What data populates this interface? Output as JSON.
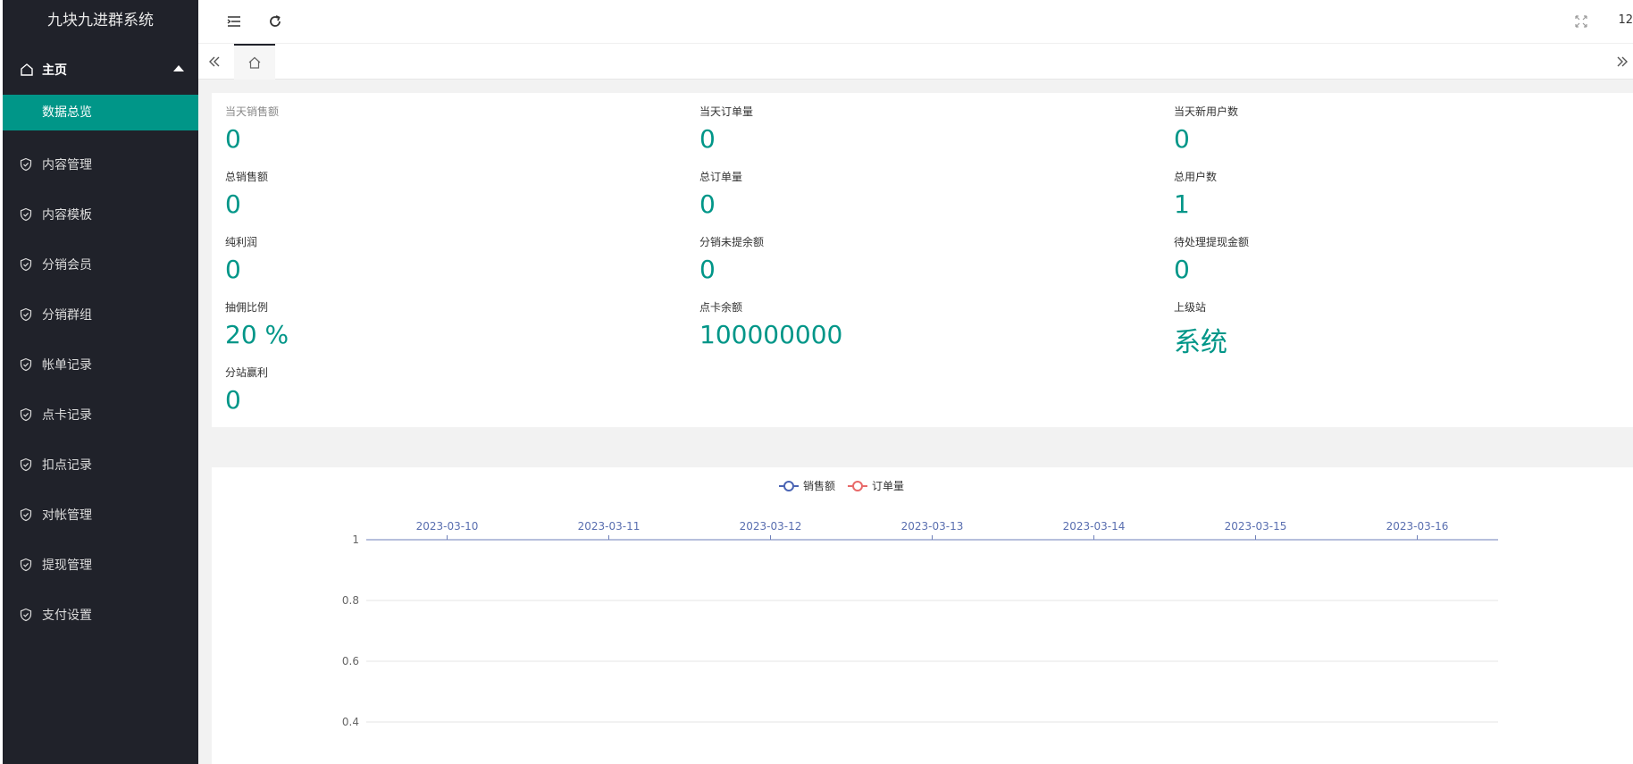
{
  "app": {
    "title": "九块九进群系统"
  },
  "sidebar": {
    "home_label": "主页",
    "sub_items": [
      {
        "label": "数据总览"
      }
    ],
    "items": [
      {
        "label": "内容管理"
      },
      {
        "label": "内容模板"
      },
      {
        "label": "分销会员"
      },
      {
        "label": "分销群组"
      },
      {
        "label": "帐单记录"
      },
      {
        "label": "点卡记录"
      },
      {
        "label": "扣点记录"
      },
      {
        "label": "对帐管理"
      },
      {
        "label": "提现管理"
      },
      {
        "label": "支付设置"
      }
    ]
  },
  "topbar": {
    "right_text": "12"
  },
  "stats": [
    {
      "label": "当天销售额",
      "value": "0"
    },
    {
      "label": "当天订单量",
      "value": "0"
    },
    {
      "label": "当天新用户数",
      "value": "0"
    },
    {
      "label": "总销售额",
      "value": "0"
    },
    {
      "label": "总订单量",
      "value": "0"
    },
    {
      "label": "总用户数",
      "value": "1"
    },
    {
      "label": "纯利润",
      "value": "0"
    },
    {
      "label": "分销未提余额",
      "value": "0"
    },
    {
      "label": "待处理提现金额",
      "value": "0"
    },
    {
      "label": "抽佣比例",
      "value": "20 %"
    },
    {
      "label": "点卡余额",
      "value": "100000000"
    },
    {
      "label": "上级站",
      "value": "系统"
    },
    {
      "label": "分站赢利",
      "value": "0"
    }
  ],
  "colors": {
    "accent": "#009688",
    "sidebar_bg": "#20222a",
    "series_sales": "#4a64b4",
    "series_orders": "#e86a6a"
  },
  "chart_data": {
    "type": "line",
    "x": [
      "2023-03-10",
      "2023-03-11",
      "2023-03-12",
      "2023-03-13",
      "2023-03-14",
      "2023-03-15",
      "2023-03-16"
    ],
    "series": [
      {
        "name": "销售额",
        "values": [
          0,
          0,
          0,
          0,
          0,
          0,
          0
        ]
      },
      {
        "name": "订单量",
        "values": [
          0,
          0,
          0,
          0,
          0,
          0,
          0
        ]
      }
    ],
    "y_ticks_visible": [
      "1",
      "0.8",
      "0.6",
      "0.4"
    ],
    "ylim": [
      0,
      1
    ],
    "x_axis_position": "top",
    "y_inverse": true,
    "legend_position": "top-center",
    "grid": true
  }
}
